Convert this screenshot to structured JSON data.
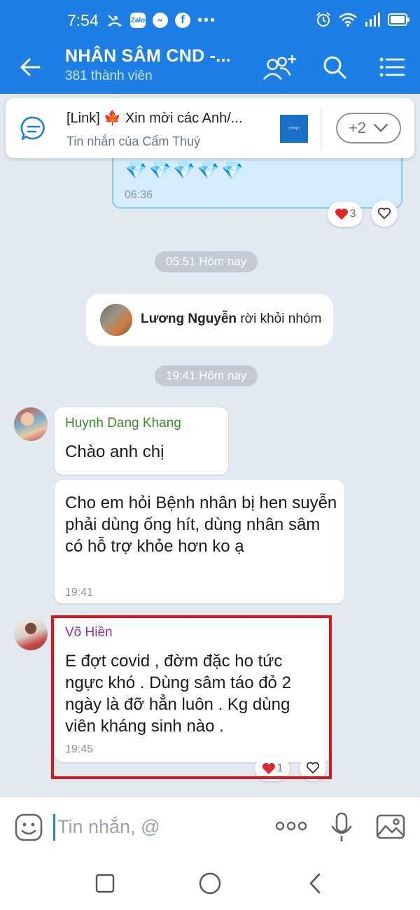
{
  "status_bar": {
    "time": "7:54",
    "left_icons": [
      "missed-call-icon",
      "zalo-icon",
      "messenger-icon",
      "facebook-icon",
      "more-dots-icon"
    ],
    "zalo_label": "Zalo",
    "right_icons": [
      "alarm-icon",
      "wifi-icon",
      "signal-icon",
      "battery-icon"
    ]
  },
  "header": {
    "title": "NHÂN SÂM CND -...",
    "subtitle": "381 thành viên",
    "buttons": [
      "add-member",
      "search",
      "menu"
    ]
  },
  "pinned": {
    "text": "[Link] 🍁 Xin mời các Anh/...",
    "sub": "Tin nhắn của Cẩm Thuý",
    "thumb_text": "CHÍNH CONTENT",
    "more_label": "+2"
  },
  "previous_message": {
    "diamonds": "💎💎💎💎💎",
    "time": "06:36",
    "reaction_count": "3"
  },
  "chips": {
    "first": "05:51 Hôm nay",
    "second": "19:41 Hôm nay"
  },
  "notice": {
    "name": "Lương Nguyễn",
    "action": " rời khỏi nhóm"
  },
  "messages": [
    {
      "sender": "Huynh Dang Khang",
      "text": "Chào anh chị"
    },
    {
      "text": "Cho em hỏi Bệnh nhân bị hen suyễn phải dùng ống hít, dùng nhân sâm có hỗ trợ khỏe hơn ko ạ",
      "time": "19:41"
    },
    {
      "sender": "Võ Hiền",
      "text": "E đợt covid , đờm đặc ho tức ngực khó . Dùng sâm táo đỏ 2 ngày là đỡ hẳn luôn . Kg dùng viên kháng sinh nào .",
      "time": "19:45",
      "reaction_count": "1"
    }
  ],
  "input": {
    "placeholder": "Tin nhắn, @"
  },
  "colors": {
    "brand": "#1d7fe6",
    "highlight": "#e0141b",
    "chat_bg": "#e2e9f1"
  }
}
